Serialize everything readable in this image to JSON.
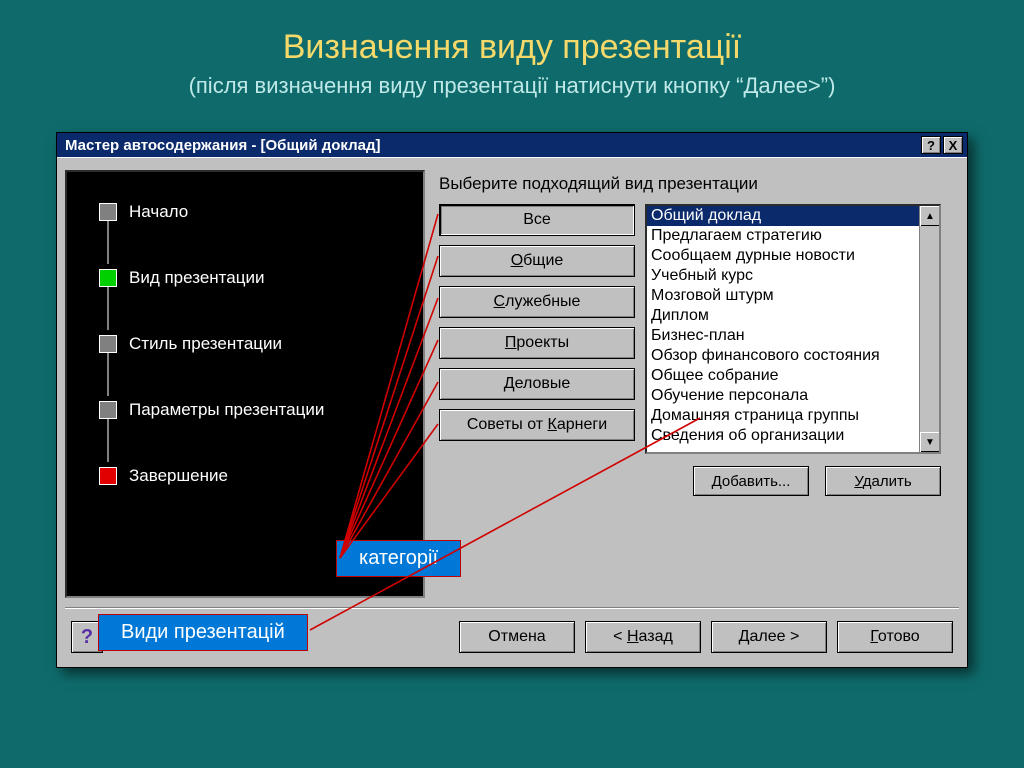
{
  "slide": {
    "title": "Визначення виду презентації",
    "subtitle": "(після визначення виду презентації натиснути кнопку “Далее>”)"
  },
  "window": {
    "title": "Мастер автосодержания - [Общий доклад]",
    "help_btn": "?",
    "close_btn": "X"
  },
  "steps": {
    "s0": "Начало",
    "s1": "Вид презентации",
    "s2": "Стиль презентации",
    "s3": "Параметры презентации",
    "s4": "Завершение"
  },
  "prompt": "Выберите подходящий вид презентации",
  "categories": {
    "c0": "Все",
    "c1": "Общие",
    "c2": "Служебные",
    "c3": "Проекты",
    "c4": "Деловые",
    "c5": "Советы от Карнеги"
  },
  "list": {
    "i0": "Общий доклад",
    "i1": "Предлагаем стратегию",
    "i2": "Сообщаем дурные новости",
    "i3": "Учебный курс",
    "i4": "Мозговой штурм",
    "i5": "Диплом",
    "i6": "Бизнес-план",
    "i7": "Обзор финансового состояния",
    "i8": "Общее собрание",
    "i9": "Обучение персонала",
    "i10": "Домашняя страница группы",
    "i11": "Сведения об организации"
  },
  "list_actions": {
    "add": "Добавить...",
    "remove": "Удалить"
  },
  "nav": {
    "cancel": "Отмена",
    "back": "< Назад",
    "next": "Далее >",
    "finish": "Готово"
  },
  "callouts": {
    "categories": "категорії",
    "types": "Види презентацій"
  },
  "hotkeys": {
    "c1_u": "О",
    "c2_u": "С",
    "c3_u": "П",
    "c4_u": "Д",
    "c5_u": "К",
    "add_u": "Д",
    "remove_u": "У",
    "back_u": "Н",
    "next_u": "Д",
    "finish_u": "Г"
  }
}
